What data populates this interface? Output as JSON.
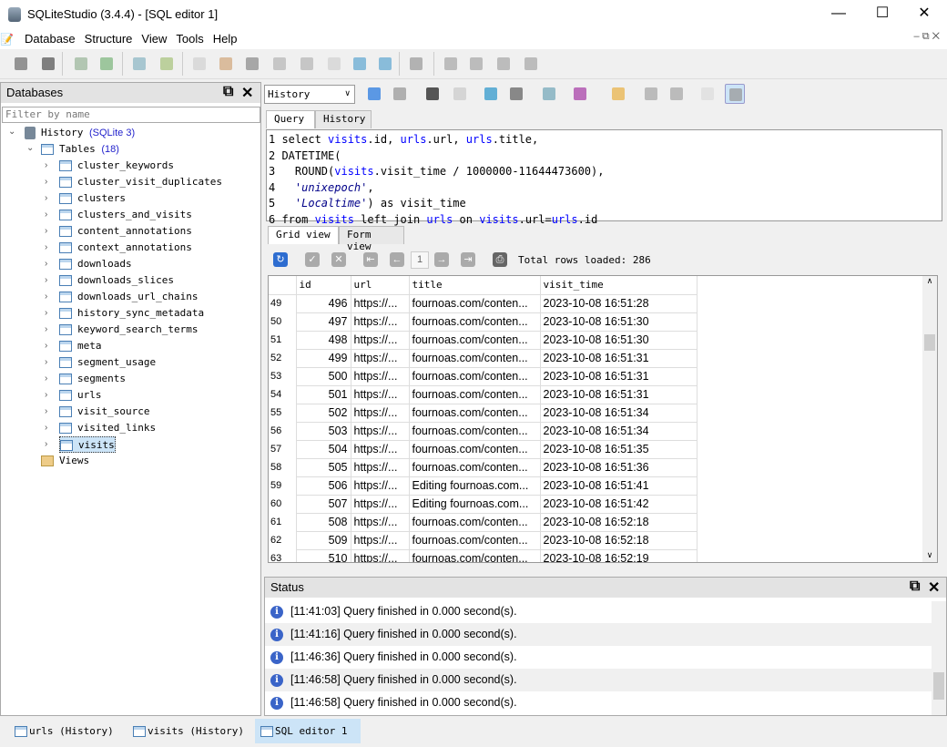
{
  "window": {
    "title": "SQLiteStudio (3.4.4) - [SQL editor 1]"
  },
  "menu": [
    "Database",
    "Structure",
    "View",
    "Tools",
    "Help"
  ],
  "databases_panel": {
    "title": "Databases",
    "filter_placeholder": "Filter by name",
    "db_name": "History",
    "db_type": "(SQLite 3)",
    "tables_label": "Tables",
    "tables_count": "(18)",
    "tables": [
      "cluster_keywords",
      "cluster_visit_duplicates",
      "clusters",
      "clusters_and_visits",
      "content_annotations",
      "context_annotations",
      "downloads",
      "downloads_slices",
      "downloads_url_chains",
      "history_sync_metadata",
      "keyword_search_terms",
      "meta",
      "segment_usage",
      "segments",
      "urls",
      "visit_source",
      "visited_links",
      "visits"
    ],
    "selected_table": "visits",
    "views_label": "Views"
  },
  "editor": {
    "database_select": "History",
    "tabs": [
      "Query",
      "History"
    ],
    "active_tab": "Query",
    "lines": [
      [
        [
          "1 ",
          ""
        ],
        [
          "select ",
          ""
        ],
        [
          "visits",
          "kw"
        ],
        [
          ".id, ",
          ""
        ],
        [
          "urls",
          "kw"
        ],
        [
          ".url, ",
          ""
        ],
        [
          "urls",
          "kw"
        ],
        [
          ".title,",
          ""
        ]
      ],
      [
        [
          "2 ",
          ""
        ],
        [
          "DATETIME(",
          ""
        ]
      ],
      [
        [
          "3 ",
          ""
        ],
        [
          "  ROUND(",
          ""
        ],
        [
          "visits",
          "kw"
        ],
        [
          ".visit_time / 1000000-11644473600),",
          ""
        ]
      ],
      [
        [
          "4 ",
          ""
        ],
        [
          "  ",
          ""
        ],
        [
          "'unixepoch'",
          "str"
        ],
        [
          ",",
          ""
        ]
      ],
      [
        [
          "5 ",
          ""
        ],
        [
          "  ",
          ""
        ],
        [
          "'Localtime'",
          "str"
        ],
        [
          ") as visit_time",
          ""
        ]
      ],
      [
        [
          "6 ",
          ""
        ],
        [
          "from ",
          ""
        ],
        [
          "visits",
          "kw"
        ],
        [
          " left join ",
          ""
        ],
        [
          "urls",
          "kw"
        ],
        [
          " on ",
          ""
        ],
        [
          "visits",
          "kw"
        ],
        [
          ".url=",
          ""
        ],
        [
          "urls",
          "kw"
        ],
        [
          ".id",
          ""
        ]
      ]
    ]
  },
  "results": {
    "tabs": [
      "Grid view",
      "Form view"
    ],
    "active_tab": "Grid view",
    "page": "1",
    "total_rows": "Total rows loaded: 286",
    "columns": [
      "id",
      "url",
      "title",
      "visit_time"
    ],
    "rows": [
      [
        "49",
        "496",
        "https://...",
        "fournoas.com/conten...",
        "2023-10-08 16:51:28"
      ],
      [
        "50",
        "497",
        "https://...",
        "fournoas.com/conten...",
        "2023-10-08 16:51:30"
      ],
      [
        "51",
        "498",
        "https://...",
        "fournoas.com/conten...",
        "2023-10-08 16:51:30"
      ],
      [
        "52",
        "499",
        "https://...",
        "fournoas.com/conten...",
        "2023-10-08 16:51:31"
      ],
      [
        "53",
        "500",
        "https://...",
        "fournoas.com/conten...",
        "2023-10-08 16:51:31"
      ],
      [
        "54",
        "501",
        "https://...",
        "fournoas.com/conten...",
        "2023-10-08 16:51:31"
      ],
      [
        "55",
        "502",
        "https://...",
        "fournoas.com/conten...",
        "2023-10-08 16:51:34"
      ],
      [
        "56",
        "503",
        "https://...",
        "fournoas.com/conten...",
        "2023-10-08 16:51:34"
      ],
      [
        "57",
        "504",
        "https://...",
        "fournoas.com/conten...",
        "2023-10-08 16:51:35"
      ],
      [
        "58",
        "505",
        "https://...",
        "fournoas.com/conten...",
        "2023-10-08 16:51:36"
      ],
      [
        "59",
        "506",
        "https://...",
        "Editing fournoas.com...",
        "2023-10-08 16:51:41"
      ],
      [
        "60",
        "507",
        "https://...",
        "Editing fournoas.com...",
        "2023-10-08 16:51:42"
      ],
      [
        "61",
        "508",
        "https://...",
        "fournoas.com/conten...",
        "2023-10-08 16:52:18"
      ],
      [
        "62",
        "509",
        "https://...",
        "fournoas.com/conten...",
        "2023-10-08 16:52:18"
      ],
      [
        "63",
        "510",
        "https://...",
        "fournoas.com/conten...",
        "2023-10-08 16:52:19"
      ]
    ]
  },
  "status": {
    "title": "Status",
    "messages": [
      [
        "[11:41:03]",
        "Query finished in 0.000 second(s)."
      ],
      [
        "[11:41:16]",
        "Query finished in 0.000 second(s)."
      ],
      [
        "[11:46:36]",
        "Query finished in 0.000 second(s)."
      ],
      [
        "[11:46:58]",
        "Query finished in 0.000 second(s)."
      ],
      [
        "[11:46:58]",
        "Query finished in 0.000 second(s)."
      ]
    ]
  },
  "taskbar": [
    "urls (History)",
    "visits (History)",
    "SQL editor 1"
  ],
  "active_window": "SQL editor 1",
  "colors": {
    "keyword": "#0000ff",
    "selection": "#cce4f7",
    "info": "#3a64c8"
  }
}
